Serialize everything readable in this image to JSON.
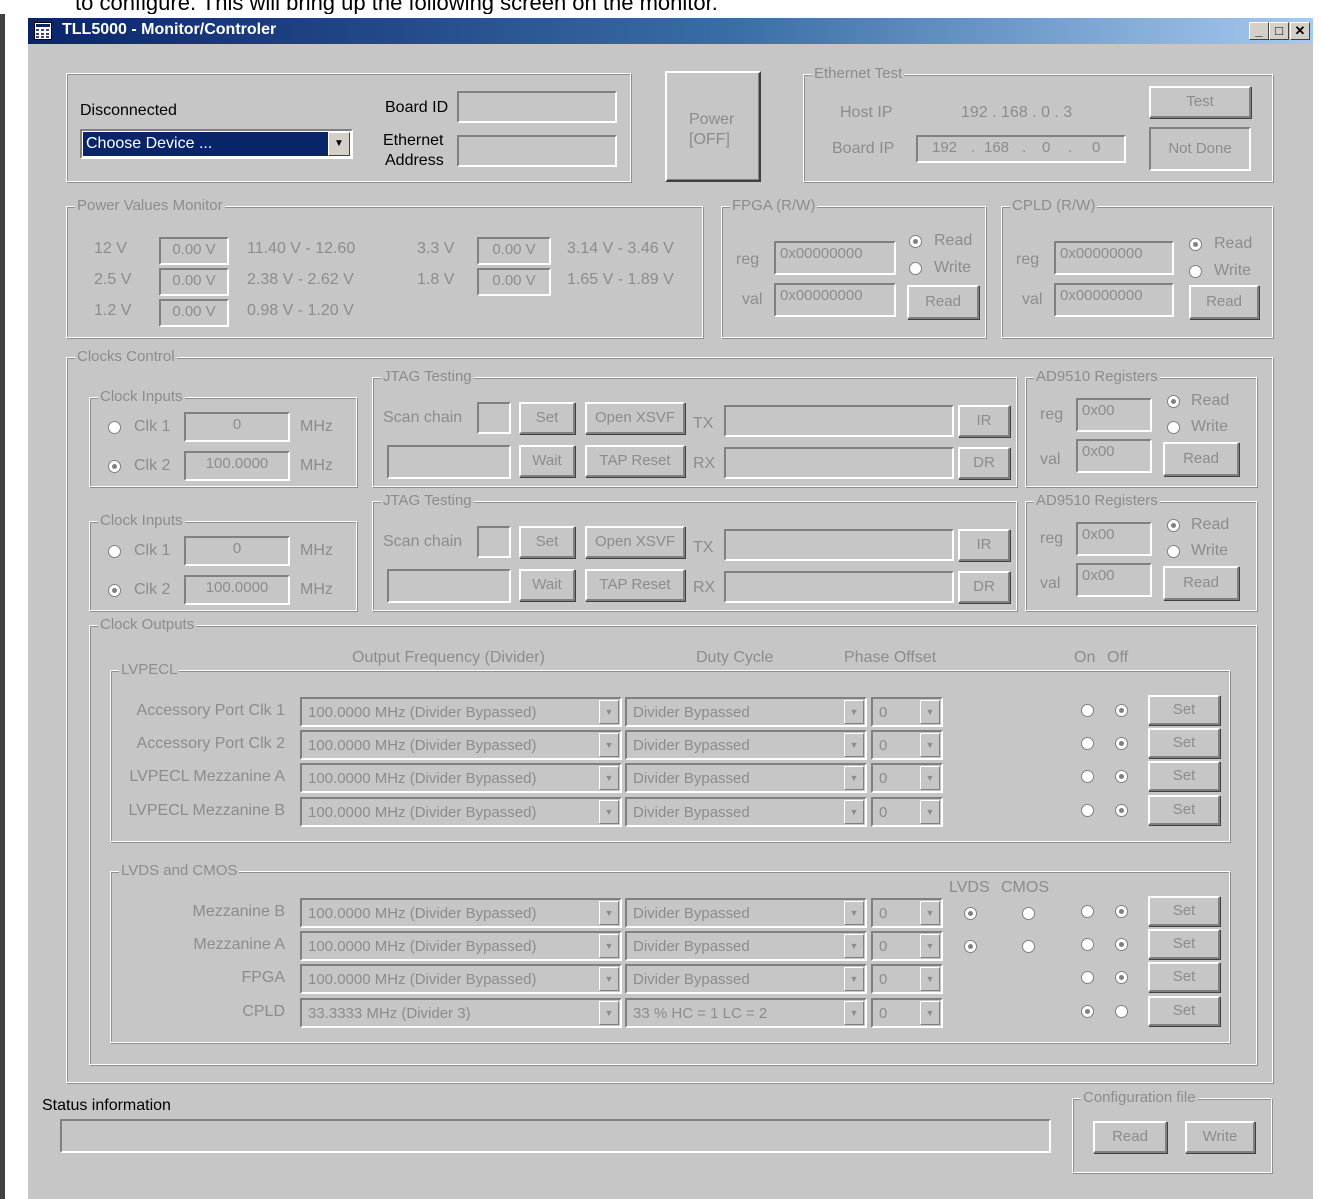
{
  "top_cut_text": "to configure. This will bring up the following screen on the monitor.",
  "window": {
    "title": "TLL5000 - Monitor/Controler",
    "icon": "grid-icon",
    "minimize": "_",
    "maximize": "□",
    "close": "✕"
  },
  "connection": {
    "status": "Disconnected",
    "device_select": "Choose Device ...",
    "board_id_label": "Board ID",
    "board_id_value": "",
    "ethernet_label_1": "Ethernet",
    "ethernet_label_2": "Address",
    "ethernet_value": ""
  },
  "power_button": {
    "line1": "Power",
    "line2": "[OFF]"
  },
  "ethernet_test": {
    "label": "Ethernet Test",
    "host_ip_label": "Host IP",
    "host_ip_value": "192 . 168 . 0 . 3",
    "board_ip_label": "Board IP",
    "board_ip": [
      "192",
      "168",
      "0",
      "0"
    ],
    "test_button": "Test",
    "result": "Not Done"
  },
  "power_monitor": {
    "label": "Power Values Monitor",
    "rows": [
      {
        "name": "12 V",
        "value": "0.00 V",
        "range": "11.40 V - 12.60"
      },
      {
        "name": "2.5 V",
        "value": "0.00 V",
        "range": "2.38 V - 2.62 V"
      },
      {
        "name": "1.2 V",
        "value": "0.00 V",
        "range": "0.98 V - 1.20 V"
      },
      {
        "name": "3.3 V",
        "value": "0.00 V",
        "range": "3.14 V - 3.46 V"
      },
      {
        "name": "1.8 V",
        "value": "0.00 V",
        "range": "1.65 V - 1.89 V"
      }
    ]
  },
  "fpga": {
    "label": "FPGA (R/W)",
    "reg_label": "reg",
    "reg_value": "0x00000000",
    "val_label": "val",
    "val_value": "0x00000000",
    "read_radio": "Read",
    "write_radio": "Write",
    "read_button": "Read"
  },
  "cpld": {
    "label": "CPLD (R/W)",
    "reg_label": "reg",
    "reg_value": "0x00000000",
    "val_label": "val",
    "val_value": "0x00000000",
    "read_radio": "Read",
    "write_radio": "Write",
    "read_button": "Read"
  },
  "clocks": {
    "label": "Clocks Control",
    "blocks": [
      {
        "clock_inputs": {
          "label": "Clock Inputs",
          "clk1": "Clk 1",
          "clk1_value": "0",
          "clk2": "Clk 2",
          "clk2_value": "100.0000",
          "unit": "MHz"
        },
        "jtag": {
          "label": "JTAG Testing",
          "scan_chain": "Scan chain",
          "set": "Set",
          "open_xsvf": "Open XSVF",
          "wait": "Wait",
          "tap_reset": "TAP Reset",
          "tx": "TX",
          "rx": "RX",
          "ir": "IR",
          "dr": "DR"
        },
        "ad9510": {
          "label": "AD9510 Registers",
          "reg_label": "reg",
          "reg_value": "0x00",
          "val_label": "val",
          "val_value": "0x00",
          "read_radio": "Read",
          "write_radio": "Write",
          "read_button": "Read"
        }
      },
      {
        "clock_inputs": {
          "label": "Clock Inputs",
          "clk1": "Clk 1",
          "clk1_value": "0",
          "clk2": "Clk 2",
          "clk2_value": "100.0000",
          "unit": "MHz"
        },
        "jtag": {
          "label": "JTAG Testing",
          "scan_chain": "Scan chain",
          "set": "Set",
          "open_xsvf": "Open XSVF",
          "wait": "Wait",
          "tap_reset": "TAP Reset",
          "tx": "TX",
          "rx": "RX",
          "ir": "IR",
          "dr": "DR"
        },
        "ad9510": {
          "label": "AD9510 Registers",
          "reg_label": "reg",
          "reg_value": "0x00",
          "val_label": "val",
          "val_value": "0x00",
          "read_radio": "Read",
          "write_radio": "Write",
          "read_button": "Read"
        }
      }
    ]
  },
  "clock_outputs": {
    "label": "Clock Outputs",
    "col_freq": "Output Frequency (Divider)",
    "col_duty": "Duty Cycle",
    "col_phase": "Phase Offset",
    "col_on": "On",
    "col_off": "Off",
    "lvpecl": {
      "label": "LVPECL",
      "rows": [
        {
          "name": "Accessory Port Clk 1",
          "freq": "100.0000 MHz    (Divider Bypassed)",
          "duty": "Divider Bypassed",
          "phase": "0",
          "set": "Set"
        },
        {
          "name": "Accessory Port Clk 2",
          "freq": "100.0000 MHz    (Divider Bypassed)",
          "duty": "Divider Bypassed",
          "phase": "0",
          "set": "Set"
        },
        {
          "name": "LVPECL Mezzanine A",
          "freq": "100.0000 MHz    (Divider Bypassed)",
          "duty": "Divider Bypassed",
          "phase": "0",
          "set": "Set"
        },
        {
          "name": "LVPECL Mezzanine B",
          "freq": "100.0000 MHz    (Divider Bypassed)",
          "duty": "Divider Bypassed",
          "phase": "0",
          "set": "Set"
        }
      ]
    },
    "lvds": {
      "label": "LVDS and CMOS",
      "col_lvds": "LVDS",
      "col_cmos": "CMOS",
      "rows": [
        {
          "name": "Mezzanine B",
          "freq": "100.0000 MHz    (Divider Bypassed)",
          "duty": "Divider Bypassed",
          "phase": "0",
          "set": "Set"
        },
        {
          "name": "Mezzanine A",
          "freq": "100.0000 MHz    (Divider Bypassed)",
          "duty": "Divider Bypassed",
          "phase": "0",
          "set": "Set"
        },
        {
          "name": "FPGA",
          "freq": "100.0000 MHz    (Divider Bypassed)",
          "duty": "Divider Bypassed",
          "phase": "0",
          "set": "Set"
        },
        {
          "name": "CPLD",
          "freq": "33.3333 MHz    (Divider 3)",
          "duty": "33 %    HC = 1    LC = 2",
          "phase": "0",
          "set": "Set"
        }
      ]
    }
  },
  "status": {
    "label": "Status information",
    "value": ""
  },
  "config_file": {
    "label": "Configuration file",
    "read": "Read",
    "write": "Write"
  }
}
